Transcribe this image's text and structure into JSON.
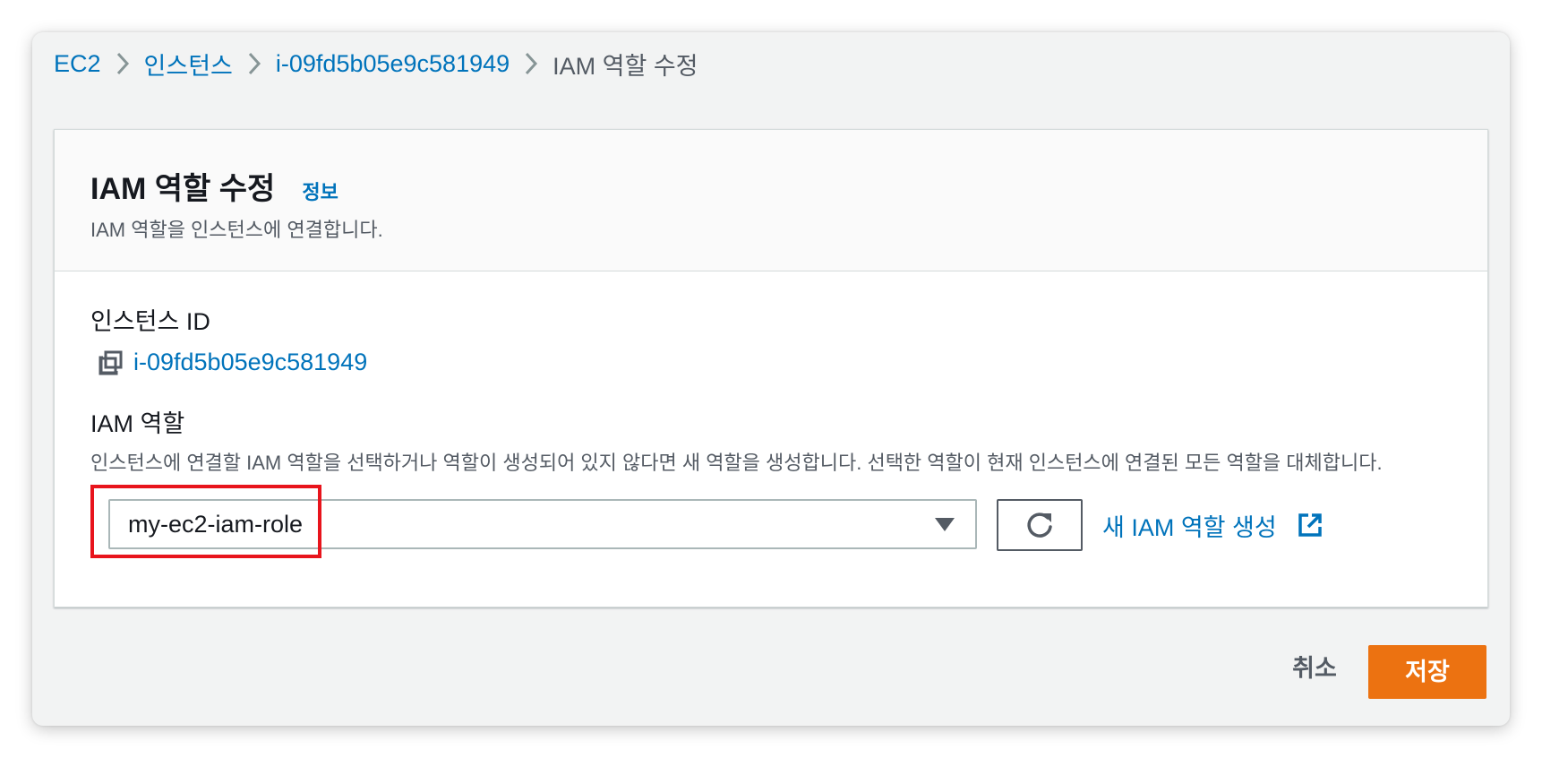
{
  "breadcrumb": {
    "items": [
      {
        "label": "EC2"
      },
      {
        "label": "인스턴스"
      },
      {
        "label": "i-09fd5b05e9c581949"
      }
    ],
    "current": "IAM 역할 수정",
    "separator_icon": "chevron-right-icon"
  },
  "panel": {
    "title": "IAM 역할 수정",
    "info_link": "정보",
    "description": "IAM 역할을 인스턴스에 연결합니다."
  },
  "instance": {
    "label": "인스턴스 ID",
    "value": "i-09fd5b05e9c581949",
    "copy_icon": "copy-icon"
  },
  "iam_role": {
    "label": "IAM 역할",
    "description": "인스턴스에 연결할 IAM 역할을 선택하거나 역할이 생성되어 있지 않다면 새 역할을 생성합니다. 선택한 역할이 현재 인스턴스에 연결된 모든 역할을 대체합니다.",
    "selected_value": "my-ec2-iam-role",
    "caret_icon": "caret-down-icon",
    "refresh_icon": "refresh-icon",
    "create_link": "새 IAM 역할 생성",
    "external_icon": "external-link-icon"
  },
  "actions": {
    "cancel_label": "취소",
    "save_label": "저장"
  },
  "colors": {
    "link": "#0073bb",
    "primary_button": "#ec7211",
    "highlight": "#e8141c",
    "background": "#f2f3f3"
  }
}
